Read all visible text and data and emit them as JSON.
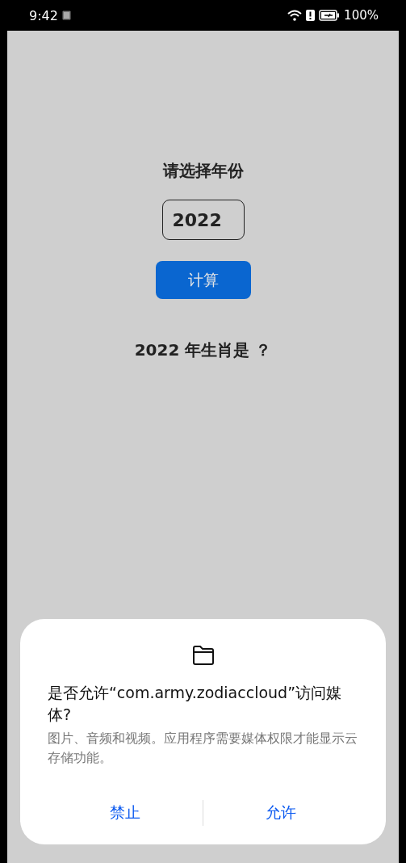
{
  "status_bar": {
    "time": "9:42",
    "battery": "100%"
  },
  "app": {
    "prompt": "请选择年份",
    "year_field": {
      "value": "2022"
    },
    "calc_button": "计算",
    "result": "2022 年生肖是 ？"
  },
  "dialog": {
    "title": "是否允许“com.army.zodiaccloud”访问媒体?",
    "message": "图片、音频和视频。应用程序需要媒体权限才能显示云存储功能。",
    "buttons": [
      {
        "label": "禁止"
      },
      {
        "label": "允许"
      }
    ]
  }
}
